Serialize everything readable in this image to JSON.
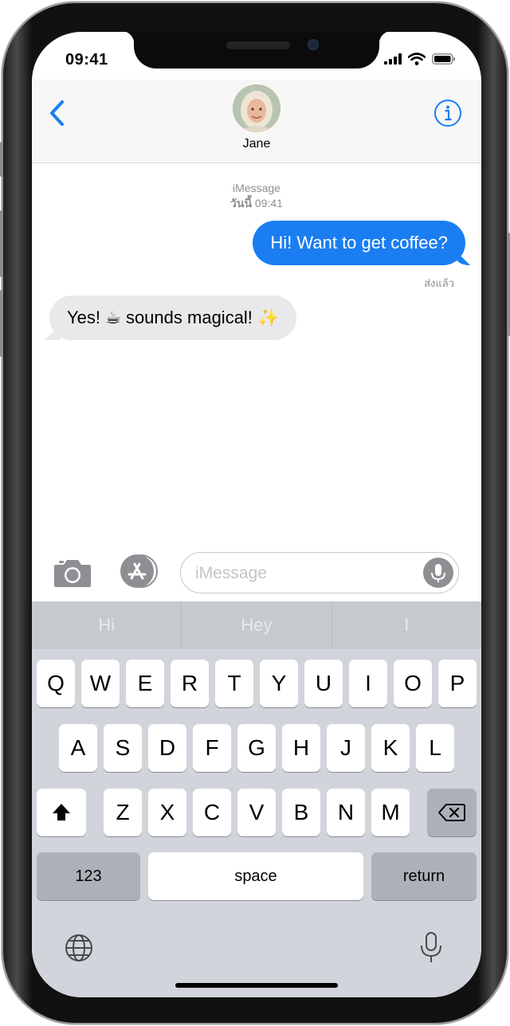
{
  "status": {
    "time": "09:41"
  },
  "header": {
    "back_label": "<",
    "contact_name": "Jane",
    "info_label": "i"
  },
  "conversation": {
    "service": "iMessage",
    "timestamp_day": "วันนี้",
    "timestamp_time": "09:41",
    "messages": [
      {
        "direction": "outgoing",
        "text": "Hi! Want to get coffee?"
      },
      {
        "direction": "incoming",
        "text": "Yes! ☕ sounds magical! ✨"
      }
    ],
    "delivered_label": "ส่งแล้ว"
  },
  "composer": {
    "placeholder": "iMessage"
  },
  "keyboard": {
    "suggestions": [
      "Hi",
      "Hey",
      "I"
    ],
    "row1": [
      "Q",
      "W",
      "E",
      "R",
      "T",
      "Y",
      "U",
      "I",
      "O",
      "P"
    ],
    "row2": [
      "A",
      "S",
      "D",
      "F",
      "G",
      "H",
      "J",
      "K",
      "L"
    ],
    "row3": [
      "Z",
      "X",
      "C",
      "V",
      "B",
      "N",
      "M"
    ],
    "numbers_label": "123",
    "space_label": "space",
    "return_label": "return"
  },
  "colors": {
    "accent": "#1a7ef2",
    "incoming_bubble": "#e9e9eb",
    "keyboard_bg": "#d1d4da"
  },
  "icons": [
    "back-chevron-icon",
    "info-icon",
    "camera-icon",
    "app-store-icon",
    "microphone-icon",
    "shift-icon",
    "delete-icon",
    "globe-icon",
    "dictation-icon",
    "signal-icon",
    "wifi-icon",
    "battery-icon"
  ]
}
